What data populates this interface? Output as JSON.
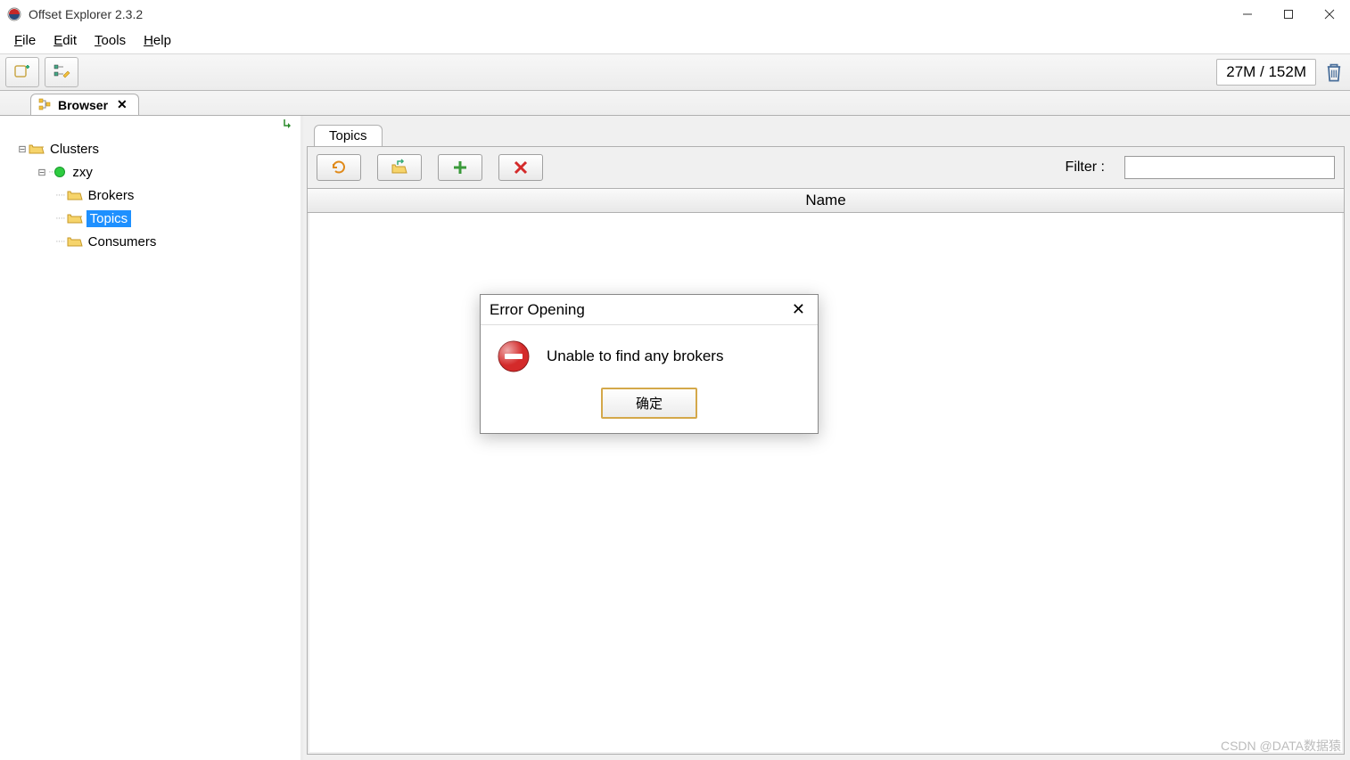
{
  "window": {
    "title": "Offset Explorer  2.3.2"
  },
  "menu": {
    "file": "File",
    "edit": "Edit",
    "tools": "Tools",
    "help": "Help"
  },
  "toolbar": {
    "memory": "27M / 152M"
  },
  "browser_tab": {
    "label": "Browser",
    "close": "✕"
  },
  "tree": {
    "root": "Clusters",
    "cluster": "zxy",
    "brokers": "Brokers",
    "topics": "Topics",
    "consumers": "Consumers"
  },
  "content": {
    "tab": "Topics",
    "filter_label": "Filter :",
    "column_name": "Name"
  },
  "dialog": {
    "title": "Error Opening",
    "message": "Unable to find any brokers",
    "ok": "确定"
  },
  "watermark": "CSDN @DATA数据猿"
}
